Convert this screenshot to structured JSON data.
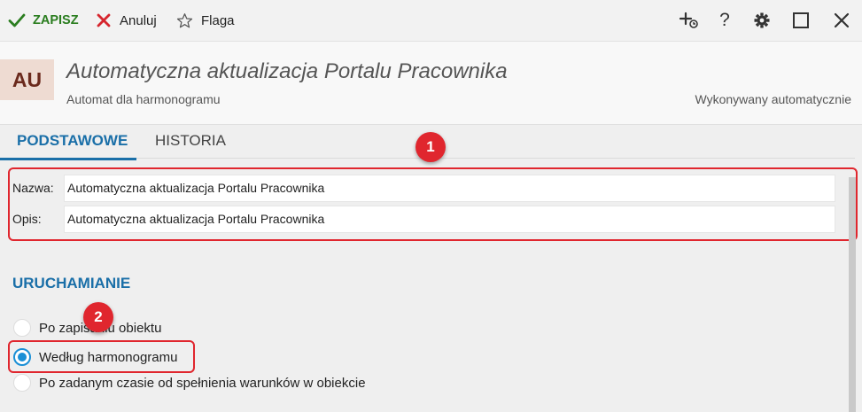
{
  "toolbar": {
    "save_label": "ZAPISZ",
    "cancel_label": "Anuluj",
    "flag_label": "Flaga",
    "icons": [
      "add-step-icon",
      "help-icon",
      "gear-icon",
      "maximize-icon",
      "close-icon"
    ],
    "help_glyph": "?"
  },
  "header": {
    "avatar": "AU",
    "title": "Automatyczna aktualizacja Portalu Pracownika",
    "subtitle": "Automat dla harmonogramu",
    "status": "Wykonywany automatycznie"
  },
  "tabs": [
    {
      "label": "PODSTAWOWE",
      "active": true
    },
    {
      "label": "HISTORIA",
      "active": false
    }
  ],
  "form": {
    "name_label": "Nazwa:",
    "name_value": "Automatyczna aktualizacja Portalu Pracownika",
    "desc_label": "Opis:",
    "desc_value": "Automatyczna aktualizacja Portalu Pracownika"
  },
  "section": {
    "title": "URUCHAMIANIE",
    "options": [
      {
        "label": "Po zapisaniu obiektu",
        "selected": false
      },
      {
        "label": "Według harmonogramu",
        "selected": true
      },
      {
        "label": "Po zadanym czasie od spełnienia warunków w obiekcie",
        "selected": false
      }
    ]
  },
  "annotations": [
    "1",
    "2"
  ],
  "colors": {
    "accent": "#1a6fa8",
    "save": "#2a7d1f",
    "cancel": "#d6262e",
    "annotation": "#e0262e",
    "radio_selected": "#1a8fd6"
  }
}
